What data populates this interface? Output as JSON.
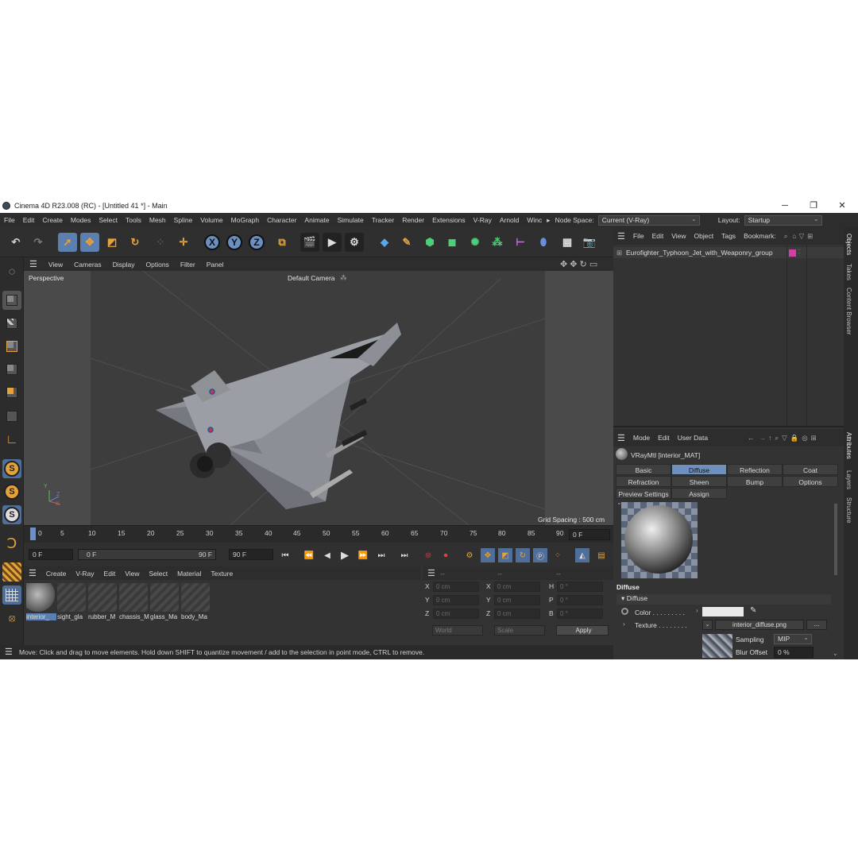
{
  "window": {
    "title": "Cinema 4D R23.008 (RC) - [Untitled 41 *] - Main",
    "controls": [
      "─",
      "❐",
      "✕"
    ]
  },
  "menubar": {
    "items": [
      "File",
      "Edit",
      "Create",
      "Modes",
      "Select",
      "Tools",
      "Mesh",
      "Spline",
      "Volume",
      "MoGraph",
      "Character",
      "Animate",
      "Simulate",
      "Tracker",
      "Render",
      "Extensions",
      "V-Ray",
      "Arnold",
      "Winc"
    ],
    "node_space_label": "Node Space:",
    "node_space_value": "Current (V-Ray)",
    "layout_label": "Layout:",
    "layout_value": "Startup"
  },
  "toolbar": {
    "axis_labels": [
      "X",
      "Y",
      "Z"
    ]
  },
  "viewport": {
    "menu": [
      "View",
      "Cameras",
      "Display",
      "Options",
      "Filter",
      "Panel"
    ],
    "view_name": "Perspective",
    "camera": "Default Camera",
    "grid_spacing": "Grid Spacing : 500 cm",
    "axis_y": "Y",
    "axis_z": "Z",
    "axis_x": "X"
  },
  "timeline": {
    "ticks": [
      "0",
      "5",
      "10",
      "15",
      "20",
      "25",
      "30",
      "35",
      "40",
      "45",
      "50",
      "55",
      "60",
      "65",
      "70",
      "75",
      "80",
      "85",
      "90"
    ],
    "current_frame": "0 F",
    "start_field": "0 F",
    "range_start": "0 F",
    "range_end": "90 F",
    "end_field": "90 F"
  },
  "material_manager": {
    "menu": [
      "Create",
      "V-Ray",
      "Edit",
      "View",
      "Select",
      "Material",
      "Texture"
    ],
    "materials": [
      "interior_",
      "sight_gla",
      "rubber_M",
      "chassis_M",
      "glass_Ma",
      "body_Ma"
    ]
  },
  "coordinates": {
    "header_dashes": [
      "--",
      "--",
      "--"
    ],
    "rows": [
      {
        "a": "X",
        "av": "0 cm",
        "b": "X",
        "bv": "0 cm",
        "c": "H",
        "cv": "0 °"
      },
      {
        "a": "Y",
        "av": "0 cm",
        "b": "Y",
        "bv": "0 cm",
        "c": "P",
        "cv": "0 °"
      },
      {
        "a": "Z",
        "av": "0 cm",
        "b": "Z",
        "bv": "0 cm",
        "c": "B",
        "cv": "0 °"
      }
    ],
    "space": "World",
    "mode": "Scale",
    "apply": "Apply"
  },
  "status": {
    "text": "Move: Click and drag to move elements. Hold down SHIFT to quantize movement / add to the selection in point mode, CTRL to remove."
  },
  "object_manager": {
    "menu": [
      "File",
      "Edit",
      "View",
      "Object",
      "Tags",
      "Bookmark:"
    ],
    "object_name": "Eurofighter_Typhoon_Jet_with_Weaponry_group",
    "tag_color": "#d63ea6"
  },
  "attribute_manager": {
    "menu": [
      "Mode",
      "Edit",
      "User Data"
    ],
    "material_title": "VRayMtl [interior_MAT]",
    "tabs": [
      "Basic",
      "Diffuse",
      "Reflection",
      "Coat",
      "Refraction",
      "Sheen",
      "Bump",
      "Options",
      "Preview Settings",
      "Assign"
    ],
    "active_tab": "Diffuse",
    "section": "Diffuse",
    "subsection": "Diffuse",
    "color_label": "Color . . . . . . . . .",
    "texture_label": "Texture . . . . . . . .",
    "texture_file": "interior_diffuse.png",
    "texture_more": "...",
    "sampling_label": "Sampling",
    "sampling_value": "MIP",
    "blur_label": "Blur Offset",
    "blur_value": "0 %"
  },
  "side_tabs": [
    "Objects",
    "Takes",
    "Content Browser",
    "Attributes",
    "Layers",
    "Structure"
  ],
  "colors": {
    "accent": "#6f8fbd",
    "orange": "#e4a23a",
    "panel": "#333333"
  }
}
